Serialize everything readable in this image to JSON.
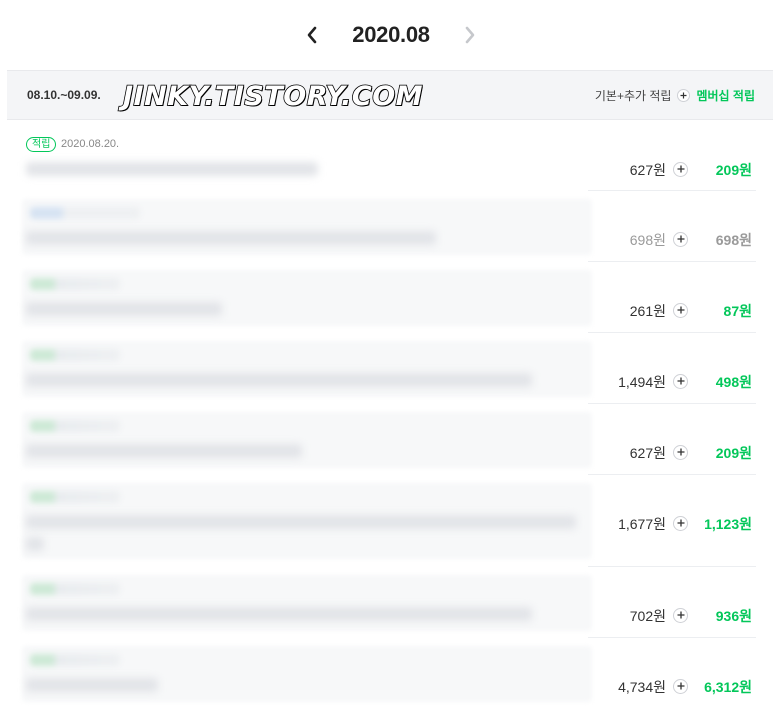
{
  "header": {
    "month": "2020.08",
    "prev_icon": "chevron-left-icon",
    "next_icon": "chevron-right-icon"
  },
  "period": {
    "range": "08.10.~09.09.",
    "watermark": "JINKY.TISTORY.COM",
    "legend_base": "기본+추가 적립",
    "legend_member": "멤버십 적립"
  },
  "colors": {
    "accent": "#03c75a",
    "muted": "#9a9a9a"
  },
  "rows": [
    {
      "badge": "적립",
      "date": "2020.08.20.",
      "base": "627원",
      "member": "209원"
    },
    {
      "base": "698원",
      "member": "698원"
    },
    {
      "base": "261원",
      "member": "87원"
    },
    {
      "base": "1,494원",
      "member": "498원"
    },
    {
      "base": "627원",
      "member": "209원"
    },
    {
      "base": "1,677원",
      "member": "1,123원"
    },
    {
      "base": "702원",
      "member": "936원"
    },
    {
      "base": "4,734원",
      "member": "6,312원"
    }
  ]
}
